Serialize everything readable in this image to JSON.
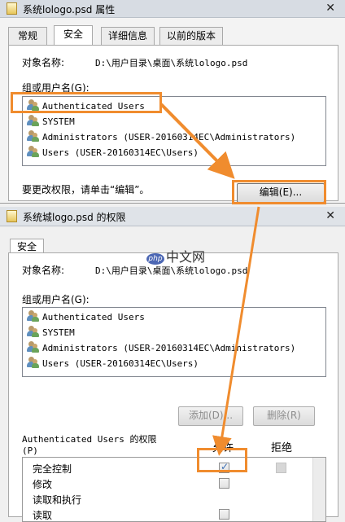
{
  "window1": {
    "title": "系统lologo.psd 属性",
    "close_glyph": "✕",
    "tabs": [
      "常规",
      "安全",
      "详细信息",
      "以前的版本"
    ],
    "object_name_label": "对象名称:",
    "object_name_value": "D:\\用户目录\\桌面\\系统lologo.psd",
    "group_label": "组或用户名(G):",
    "users": [
      "Authenticated Users",
      "SYSTEM",
      "Administrators (USER-20160314EC\\Administrators)",
      "Users (USER-20160314EC\\Users)"
    ],
    "change_hint": "要更改权限，请单击“编辑”。",
    "edit_button": "编辑(E)..."
  },
  "window2": {
    "title": "系统城logo.psd 的权限",
    "close_glyph": "✕",
    "tab": "安全",
    "object_name_label": "对象名称:",
    "object_name_value": "D:\\用户目录\\桌面\\系统lologo.psd",
    "group_label": "组或用户名(G):",
    "users": [
      "Authenticated Users",
      "SYSTEM",
      "Administrators (USER-20160314EC\\Administrators)",
      "Users (USER-20160314EC\\Users)"
    ],
    "add_button": "添加(D)...",
    "remove_button": "删除(R)",
    "perm_label_line1": "Authenticated Users 的权限",
    "perm_label_line2": "(P)",
    "allow_header": "允许",
    "deny_header": "拒绝",
    "permissions": [
      "完全控制",
      "修改",
      "读取和执行",
      "读取"
    ]
  },
  "watermark": {
    "logo_text": "php",
    "text": "中文网"
  },
  "colors": {
    "highlight": "#f08c2e",
    "check": "#3b6fb5"
  }
}
